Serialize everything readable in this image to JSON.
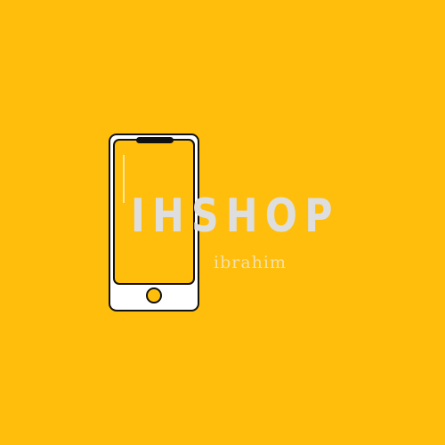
{
  "logo": {
    "brand_name": "IHSHOP",
    "tagline": "ibrahim",
    "icon": "smartphone-icon"
  },
  "colors": {
    "background": "#FFBE0B",
    "phone_outline": "#111111",
    "phone_body": "#FFFFFF",
    "phone_screen": "#FFBE0B",
    "brand_text": "#DEDEDE",
    "tagline_text": "#F5E0A8"
  }
}
